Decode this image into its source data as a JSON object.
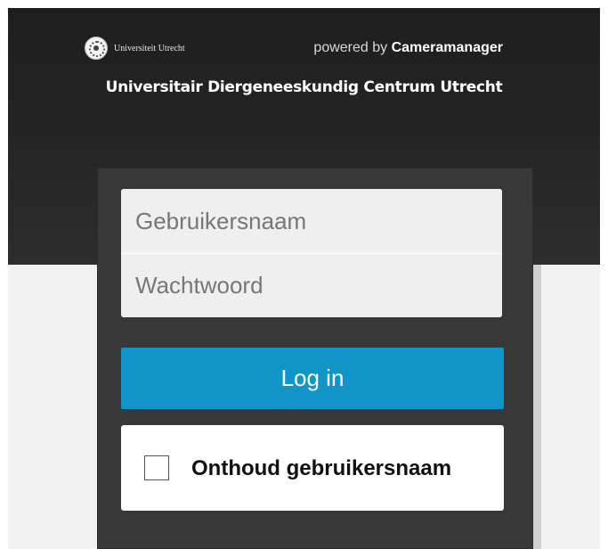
{
  "header": {
    "university_logo_text": "Universiteit Utrecht",
    "powered_prefix": "powered by",
    "powered_brand": "Cameramanager",
    "site_title": "Universitair Diergeneeskundig Centrum Utrecht"
  },
  "login": {
    "username_placeholder": "Gebruikersnaam",
    "password_placeholder": "Wachtwoord",
    "submit_label": "Log in",
    "remember_label": "Onthoud gebruikersnaam",
    "remember_checked": false
  },
  "colors": {
    "header_background": "#262626",
    "panel_background": "#383838",
    "button_accent": "#1195c9",
    "page_background": "#f2f2f3"
  }
}
